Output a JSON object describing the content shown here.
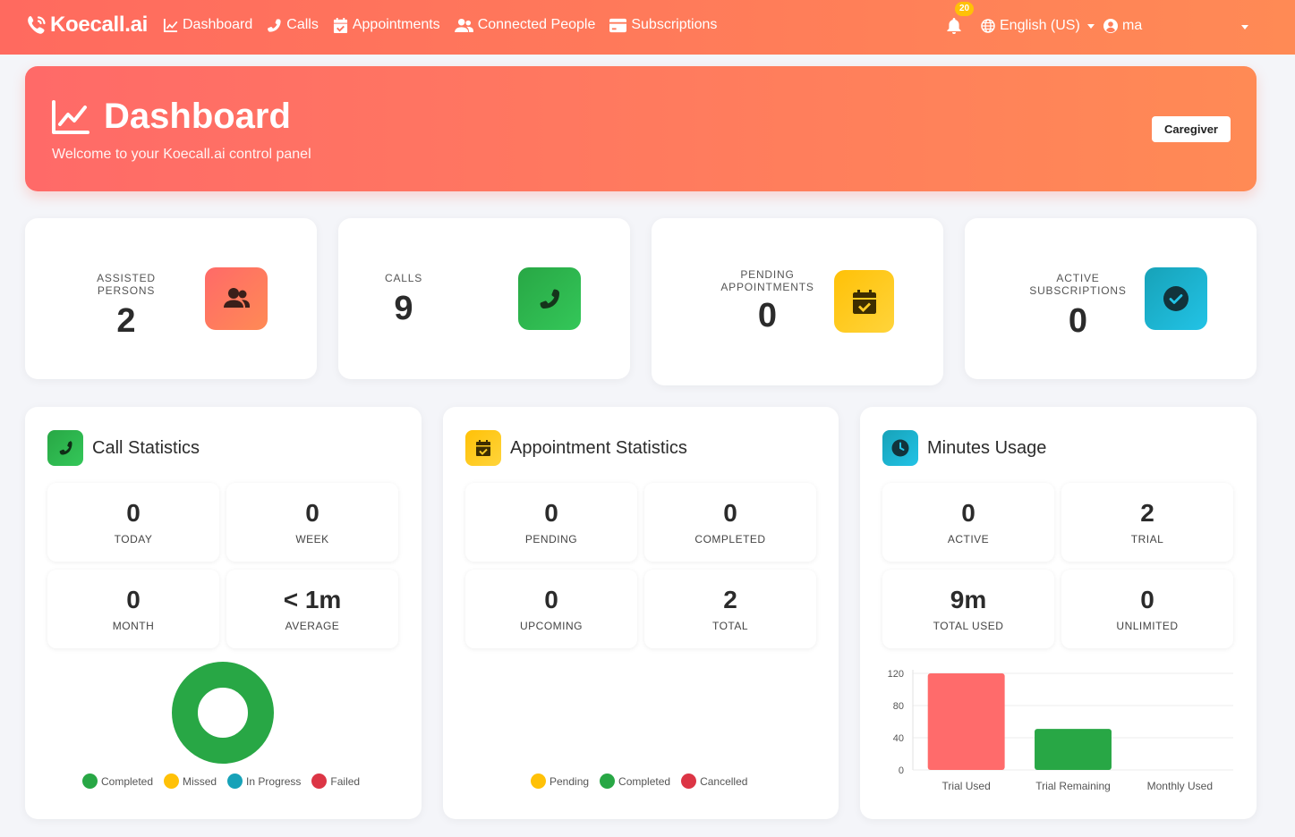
{
  "navbar": {
    "brand": "Koecall.ai",
    "links": [
      {
        "label": "Dashboard",
        "icon": "chart-line-icon"
      },
      {
        "label": "Calls",
        "icon": "phone-icon"
      },
      {
        "label": "Appointments",
        "icon": "calendar-check-icon"
      },
      {
        "label": "Connected People",
        "icon": "users-icon"
      },
      {
        "label": "Subscriptions",
        "icon": "credit-card-icon"
      }
    ],
    "notifications_count": "20",
    "language": "English (US)",
    "user": "ma"
  },
  "hero": {
    "title": "Dashboard",
    "subtitle": "Welcome to your Koecall.ai control panel",
    "role": "Caregiver"
  },
  "stats": [
    {
      "label": "ASSISTED PERSONS",
      "value": "2",
      "icon": "users-icon",
      "color": "#ff6d5f"
    },
    {
      "label": "CALLS",
      "value": "9",
      "icon": "phone-icon",
      "color": "#2db84d"
    },
    {
      "label": "PENDING APPOINTMENTS",
      "value": "0",
      "icon": "calendar-check-icon",
      "color": "#ffc414"
    },
    {
      "label": "ACTIVE SUBSCRIPTIONS",
      "value": "0",
      "icon": "check-circle-icon",
      "color": "#1ab8d6"
    }
  ],
  "call_stats": {
    "title": "Call Statistics",
    "tiles": [
      {
        "value": "0",
        "label": "TODAY"
      },
      {
        "value": "0",
        "label": "WEEK"
      },
      {
        "value": "0",
        "label": "MONTH"
      },
      {
        "value": "< 1m",
        "label": "AVERAGE"
      }
    ],
    "legend": [
      {
        "name": "Completed",
        "color": "#28a745"
      },
      {
        "name": "Missed",
        "color": "#ffc107"
      },
      {
        "name": "In Progress",
        "color": "#17a2b8"
      },
      {
        "name": "Failed",
        "color": "#dc3545"
      }
    ]
  },
  "appt_stats": {
    "title": "Appointment Statistics",
    "tiles": [
      {
        "value": "0",
        "label": "PENDING"
      },
      {
        "value": "0",
        "label": "COMPLETED"
      },
      {
        "value": "0",
        "label": "UPCOMING"
      },
      {
        "value": "2",
        "label": "TOTAL"
      }
    ],
    "legend": [
      {
        "name": "Pending",
        "color": "#ffc107"
      },
      {
        "name": "Completed",
        "color": "#28a745"
      },
      {
        "name": "Cancelled",
        "color": "#dc3545"
      }
    ]
  },
  "minutes": {
    "title": "Minutes Usage",
    "tiles": [
      {
        "value": "0",
        "label": "ACTIVE"
      },
      {
        "value": "2",
        "label": "TRIAL"
      },
      {
        "value": "9m",
        "label": "TOTAL USED"
      },
      {
        "value": "0",
        "label": "UNLIMITED"
      }
    ]
  },
  "chart_data": [
    {
      "type": "pie",
      "categories": [
        "Completed",
        "Missed",
        "In Progress",
        "Failed"
      ],
      "values": [
        9,
        0,
        0,
        0
      ],
      "colors": [
        "#28a745",
        "#ffc107",
        "#17a2b8",
        "#dc3545"
      ],
      "legend": "bottom"
    },
    {
      "type": "bar",
      "categories": [
        "Trial Used",
        "Trial Remaining",
        "Monthly Used"
      ],
      "values": [
        120,
        51,
        0
      ],
      "colors": [
        "#ff6b6b",
        "#28a745",
        "#17a2b8"
      ],
      "ylim": [
        0,
        120
      ],
      "yticks": [
        0,
        40,
        80,
        120
      ],
      "grid": true
    }
  ]
}
